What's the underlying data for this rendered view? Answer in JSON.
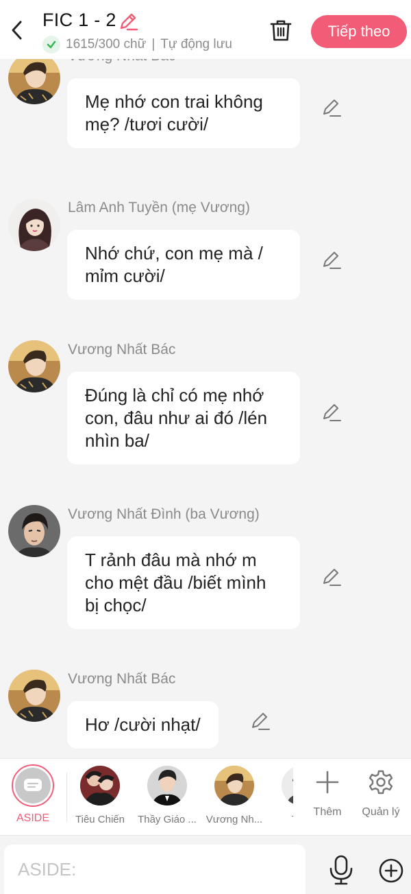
{
  "header": {
    "title": "FIC 1 - 2",
    "word_count": "1615/300 chữ",
    "autosave": "Tự động lưu",
    "next_label": "Tiếp theo"
  },
  "colors": {
    "accent": "#f25c76",
    "ok": "#3bb55a"
  },
  "messages": [
    {
      "speaker": "Vương Nhất Bác",
      "text": "Mẹ nhớ con trai không mẹ? /tươi cười/",
      "avatar": "avatar-bac"
    },
    {
      "speaker": "Lâm Anh Tuyền (mẹ Vương)",
      "text": "Nhớ chứ, con mẹ mà / mỉm cười/",
      "avatar": "avatar-tuyen"
    },
    {
      "speaker": "Vương Nhất Bác",
      "text": "Đúng là chỉ có mẹ nhớ con, đâu như ai đó /lén nhìn ba/",
      "avatar": "avatar-bac"
    },
    {
      "speaker": "Vương Nhất Đình (ba Vương)",
      "text": "T rảnh đâu mà nhớ m cho mệt đầu /biết mình bị chọc/",
      "avatar": "avatar-dinh"
    },
    {
      "speaker": "Vương Nhất Bác",
      "text": "Hơ /cười nhạt/",
      "avatar": "avatar-bac"
    }
  ],
  "characters": {
    "aside_label": "ASIDE",
    "items": [
      {
        "label": "Tiêu Chiến"
      },
      {
        "label": "Thầy Giáo ..."
      },
      {
        "label": "Vương Nh..."
      },
      {
        "label": "Tiêu"
      }
    ],
    "add_label": "Thêm",
    "manage_label": "Quản lý"
  },
  "input": {
    "placeholder": "ASIDE:"
  }
}
